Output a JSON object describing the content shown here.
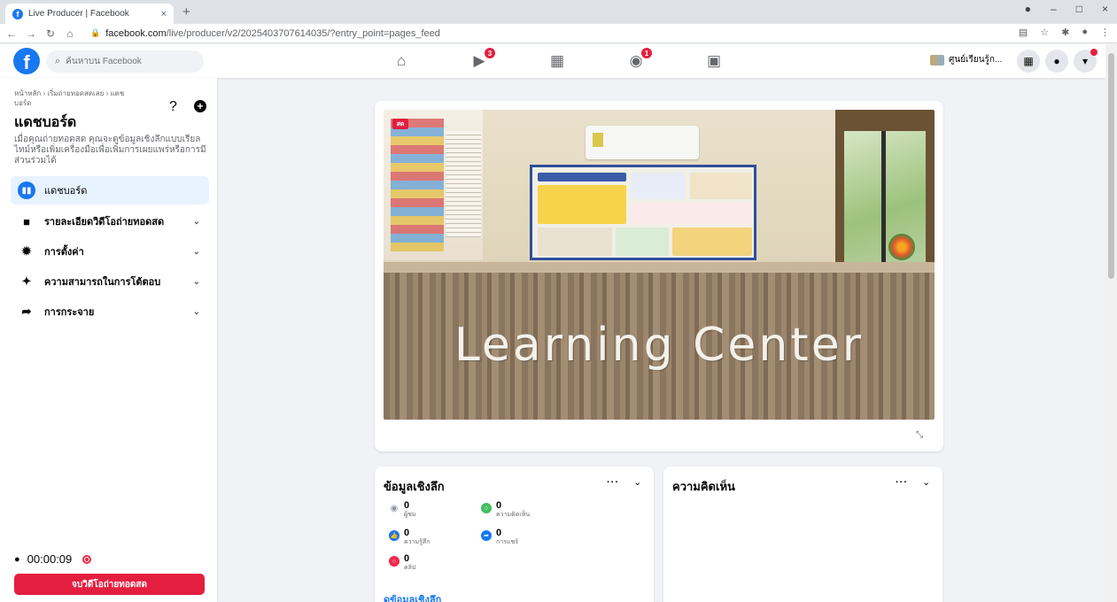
{
  "browser": {
    "tab_title": "Live Producer | Facebook",
    "tab_close": "×",
    "new_tab": "+",
    "url_host": "facebook.com",
    "url_path": "/live/producer/v2/2025403707614035/?entry_point=pages_feed",
    "window_controls": [
      "–",
      "□",
      "×"
    ]
  },
  "header": {
    "search_placeholder": "ค้นหาบน Facebook",
    "notifications_video": "3",
    "notifications_groups": "1",
    "page_name": "ศูนย์เรียนรู้ก..."
  },
  "sidebar": {
    "breadcrumb": "หน้าหลัก › เริ่มถ่ายทอดสดเลย › แดชบอร์ด",
    "help": "?",
    "title": "แดชบอร์ด",
    "description": "เมื่อคุณถ่ายทอดสด คุณจะดูข้อมูลเชิงลึกแบบเรียลไทม์หรือเพิ่มเครื่องมือเพื่อเพิ่มการเผยแพร่หรือการมีส่วนร่วมได้",
    "items": [
      {
        "label": "แดชบอร์ด",
        "icon": "dashboard-icon"
      },
      {
        "label": "รายละเอียดวิดีโอถ่ายทอดสด",
        "icon": "video-camera-icon"
      },
      {
        "label": "การตั้งค่า",
        "icon": "gear-icon"
      },
      {
        "label": "ความสามารถในการโต้ตอบ",
        "icon": "sparkle-icon"
      },
      {
        "label": "การกระจาย",
        "icon": "share-arrow-icon"
      }
    ],
    "timer": "00:00:09",
    "end_button": "จบวิดีโอถ่ายทอดสด"
  },
  "video": {
    "live_badge": "สด",
    "sign_text": "Learning Center"
  },
  "insights": {
    "title": "ข้อมูลเชิงลึก",
    "more": "···",
    "metrics": [
      {
        "value": "0",
        "label": "ผู้ชม",
        "color": "#8d949e"
      },
      {
        "value": "0",
        "label": "ความคิดเห็น",
        "color": "#45bd62"
      },
      {
        "value": "0",
        "label": "ความรู้สึก",
        "color": "#1877f2"
      },
      {
        "value": "0",
        "label": "การแชร์",
        "color": "#1877f2"
      },
      {
        "value": "0",
        "label": "คลิป",
        "color": "#f02849"
      }
    ],
    "link": "ดูข้อมูลเชิงลึก"
  },
  "comments": {
    "title": "ความคิดเห็น",
    "more": "···"
  },
  "colors": {
    "brand": "#1877f2",
    "live_red": "#e41e3f"
  }
}
